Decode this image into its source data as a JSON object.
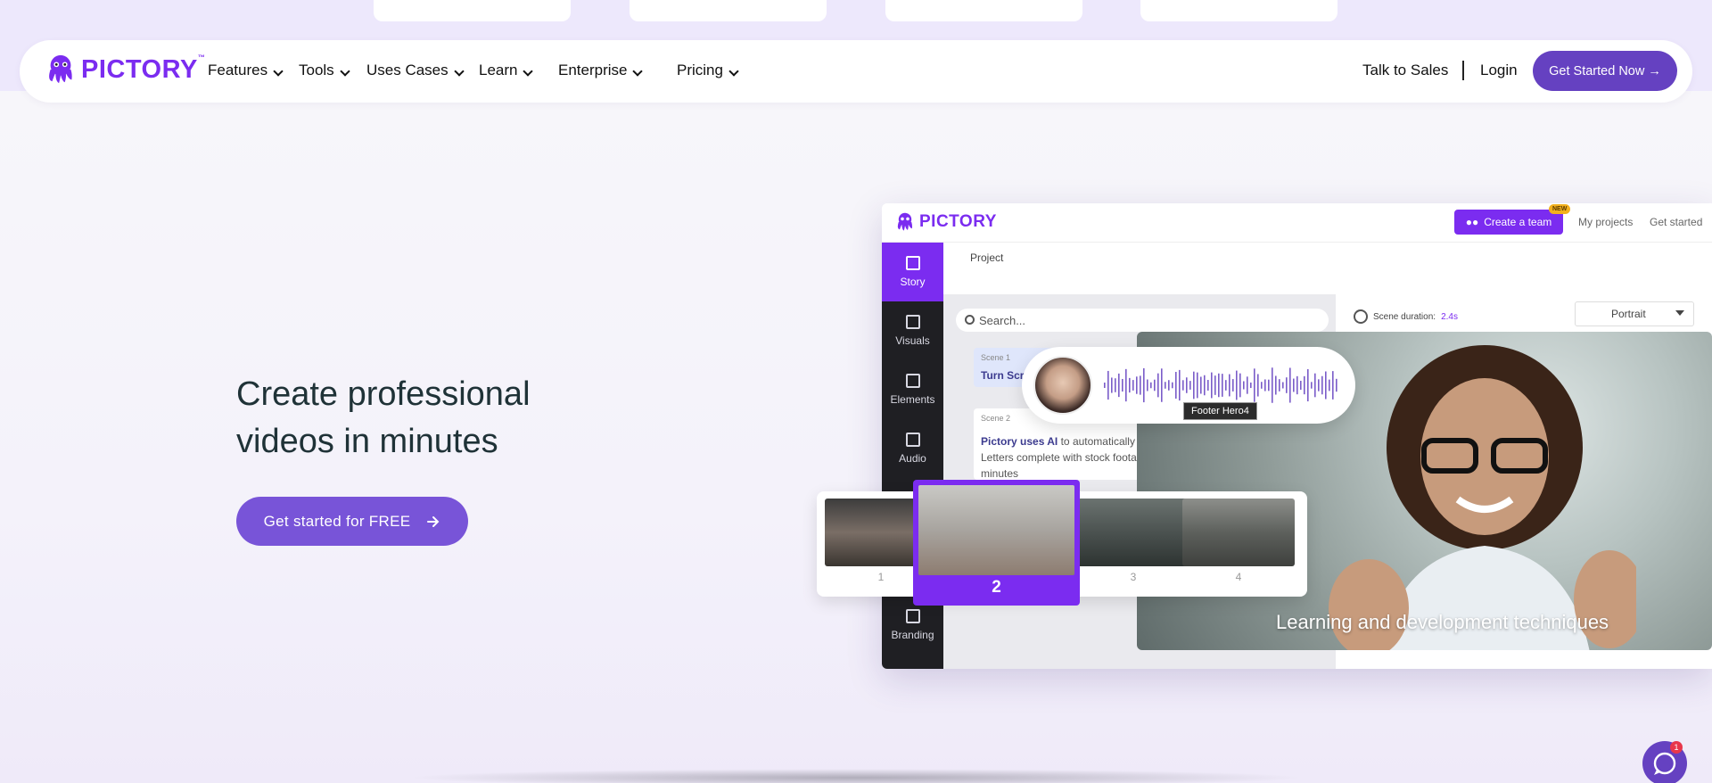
{
  "brand": {
    "name": "PICTORY",
    "tm": "™",
    "accent": "#7b2cf0",
    "button": "#6541c1"
  },
  "nav": {
    "items": [
      {
        "label": "Features"
      },
      {
        "label": "Tools"
      },
      {
        "label": "Uses Cases"
      },
      {
        "label": "Learn"
      },
      {
        "label": "Enterprise"
      },
      {
        "label": "Pricing"
      }
    ],
    "talk_to_sales": "Talk to Sales",
    "login": "Login",
    "cta": "Get Started Now →"
  },
  "hero": {
    "title": "Create professional videos in minutes",
    "button": "Get started for FREE"
  },
  "app": {
    "logo": "PICTORY",
    "create_team": "Create a team",
    "new_badge": "NEW",
    "my_projects": "My projects",
    "get_started": "Get started",
    "project_label": "Project",
    "search_placeholder": "Search...",
    "sidebar": [
      {
        "label": "Story",
        "icon": "story-icon"
      },
      {
        "label": "Visuals",
        "icon": "image-icon"
      },
      {
        "label": "Elements",
        "icon": "elements-icon"
      },
      {
        "label": "Audio",
        "icon": "music-icon"
      },
      {
        "label": "Branding",
        "icon": "briefcase-icon"
      }
    ],
    "scene_duration_label": "Scene duration:",
    "scene_duration_value": "2.4s",
    "orientation": "Portrait",
    "scene1": {
      "title": "Scene 1",
      "text": "Turn Scri"
    },
    "scene2": {
      "title": "Scene 2",
      "text_bold": "Pictory uses AI",
      "text_rest": " to automatically cr Letters complete with stock footag minutes"
    },
    "audio_tag": "Footer Hero4",
    "caption": "Learning and development techniques",
    "thumbnails": [
      "1",
      "2",
      "3",
      "4"
    ],
    "active_thumbnail": "2"
  },
  "chat": {
    "badge": "1"
  }
}
